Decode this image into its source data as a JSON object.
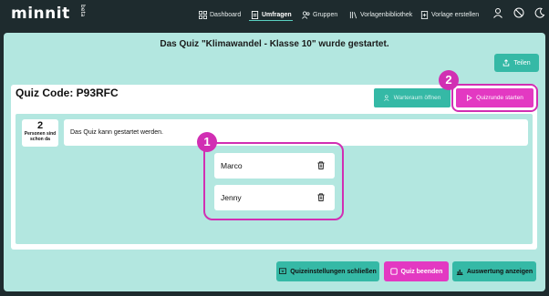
{
  "nav": {
    "logo": "minnit",
    "beta": "beta",
    "items": [
      {
        "label": "Dashboard",
        "icon": "grid-icon"
      },
      {
        "label": "Umfragen",
        "icon": "document-icon"
      },
      {
        "label": "Gruppen",
        "icon": "users-icon"
      },
      {
        "label": "Vorlagenbibliothek",
        "icon": "library-icon"
      },
      {
        "label": "Vorlage erstellen",
        "icon": "add-document-icon"
      }
    ],
    "right_icons": [
      "user-icon",
      "globe-icon",
      "moon-icon"
    ]
  },
  "header": {
    "title": "Das Quiz \"Klimawandel - Klasse 10\" wurde gestartet.",
    "share_label": "Teilen"
  },
  "quiz": {
    "code_label": "Quiz Code: P93RFC",
    "waiting_room_label": "Warteraum öffnen",
    "start_round_label": "Quizrunde starten",
    "count": "2",
    "count_caption_1": "Personen sind",
    "count_caption_2": "schon da",
    "status_message": "Das Quiz kann gestartet werden.",
    "players": [
      "Marco",
      "Jenny"
    ]
  },
  "badges": [
    "1",
    "2"
  ],
  "footer": {
    "close_settings_label": "Quizeinstellungen schließen",
    "end_quiz_label": "Quiz beenden",
    "show_results_label": "Auswertung anzeigen"
  },
  "colors": {
    "accent_teal": "#35b9a6",
    "accent_pink": "#e339c2",
    "bg_mint": "#b3e7e0",
    "dark": "#1e2b2e"
  }
}
